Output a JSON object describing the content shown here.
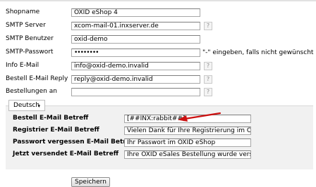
{
  "fields": [
    {
      "label": "Shopname",
      "value": "OXID eShop 4",
      "help": false
    },
    {
      "label": "SMTP Server",
      "value": "xcom-mail-01.inxserver.de",
      "help": true
    },
    {
      "label": "SMTP Benutzer",
      "value": "oxid-demo",
      "help": false
    },
    {
      "label": "SMTP-Passwort",
      "value": "••••••••",
      "help": true
    },
    {
      "label": "Info E-Mail",
      "value": "info@oxid-demo.invalid",
      "help": true
    },
    {
      "label": "Bestell E-Mail Reply",
      "value": "reply@oxid-demo.invalid",
      "help": true
    },
    {
      "label": "Bestellungen an",
      "value": "",
      "help": true
    }
  ],
  "password_note": "\"-\" eingeben, falls nicht gewünscht",
  "help_glyph": "?",
  "language_tab": {
    "label": "Deutsch",
    "caret": "▾"
  },
  "subjects": [
    {
      "label": "Bestell E-Mail Betreff",
      "value": "[##INX:rabbit##]"
    },
    {
      "label": "Registrier E-Mail Betreff",
      "value": "Vielen Dank für Ihre Registrierung im OX"
    },
    {
      "label": "Passwort vergessen E-Mail Betreff",
      "value": "Ihr Passwort im OXID eShop"
    },
    {
      "label": "Jetzt versendet E-Mail Betreff",
      "value": "Ihre OXID eSales Bestellung wurde versa"
    }
  ],
  "save_label": "Speichern",
  "colors": {
    "arrow": "#cc1111",
    "panel": "#f1f1f1"
  }
}
